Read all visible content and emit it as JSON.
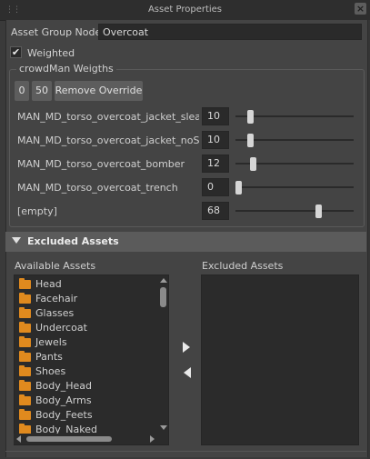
{
  "window": {
    "title": "Asset Properties",
    "close_symbol": "×"
  },
  "asset_group": {
    "label": "Asset Group Node",
    "value": "Overcoat"
  },
  "weighted": {
    "label": "Weighted",
    "checked": true
  },
  "weights_group": {
    "title": "crowdMan Weigths",
    "buttons": [
      "0",
      "50",
      "Remove Override"
    ],
    "rows": [
      {
        "label": "MAN_MD_torso_overcoat_jacket_sleaves",
        "value": "10",
        "slider_fraction": 0.1
      },
      {
        "label": "MAN_MD_torso_overcoat_jacket_noSleaves",
        "value": "10",
        "slider_fraction": 0.1
      },
      {
        "label": "MAN_MD_torso_overcoat_bomber",
        "value": "12",
        "slider_fraction": 0.12
      },
      {
        "label": "MAN_MD_torso_overcoat_trench",
        "value": "0",
        "slider_fraction": 0.0
      },
      {
        "label": "[empty]",
        "value": "68",
        "slider_fraction": 0.68
      }
    ]
  },
  "excluded_section": {
    "title": "Excluded Assets",
    "available_label": "Available Assets",
    "excluded_label": "Excluded Assets",
    "available_items": [
      "Head",
      "Facehair",
      "Glasses",
      "Undercoat",
      "Jewels",
      "Pants",
      "Shoes",
      "Body_Head",
      "Body_Arms",
      "Body_Feets",
      "Body_Naked"
    ],
    "excluded_items": []
  },
  "icons": {
    "folder": "folder-icon",
    "move_right": "arrow-right-icon",
    "move_left": "arrow-left-icon",
    "collapse": "triangle-down-icon"
  },
  "colors": {
    "folder": "#e08a1e",
    "background": "#444444",
    "field": "#2a2a2a"
  }
}
